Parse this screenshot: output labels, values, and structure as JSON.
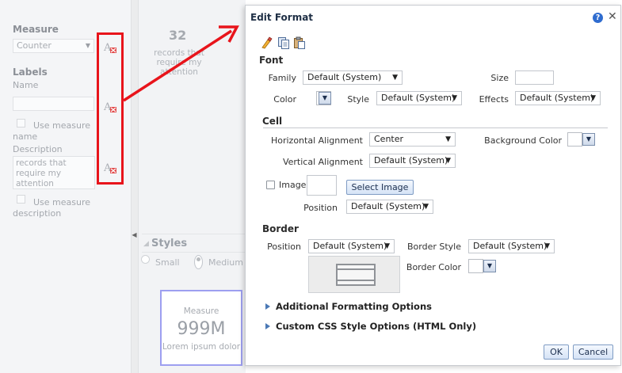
{
  "left_panel": {
    "measure_heading": "Measure",
    "measure_select": "Counter",
    "labels_heading": "Labels",
    "name_label": "Name",
    "name_value": "",
    "use_measure_name_line1": "Use measure",
    "use_measure_name_line2": "name",
    "description_label": "Description",
    "description_value": "records that require my attention",
    "use_measure_desc_line1": "Use measure",
    "use_measure_desc_line2": "description"
  },
  "tile": {
    "count": "32",
    "text": "records that require my attention"
  },
  "styles": {
    "heading": "Styles",
    "small": "Small",
    "medium": "Medium"
  },
  "preview": {
    "measure": "Measure",
    "value": "999M",
    "lorem": "Lorem ipsum dolor"
  },
  "dialog": {
    "title": "Edit Format",
    "help": "?",
    "close": "✕",
    "font": {
      "heading": "Font",
      "family_label": "Family",
      "family_value": "Default (System)",
      "size_label": "Size",
      "size_value": "",
      "color_label": "Color",
      "style_label": "Style",
      "style_value": "Default (System)",
      "effects_label": "Effects",
      "effects_value": "Default (System)"
    },
    "cell": {
      "heading": "Cell",
      "halign_label": "Horizontal Alignment",
      "halign_value": "Center",
      "bg_color_label": "Background Color",
      "valign_label": "Vertical Alignment",
      "valign_value": "Default (System)",
      "image_label": "Image",
      "select_image": "Select Image",
      "position_label": "Position",
      "position_value": "Default (System)"
    },
    "border": {
      "heading": "Border",
      "position_label": "Position",
      "position_value": "Default (System)",
      "style_label": "Border Style",
      "style_value": "Default (System)",
      "color_label": "Border Color"
    },
    "additional": "Additional Formatting Options",
    "custom_css": "Custom CSS Style Options (HTML Only)",
    "ok": "OK",
    "cancel": "Cancel"
  },
  "colors": {
    "annotation_red": "#e8141b",
    "help_blue": "#2f6ccf",
    "preview_border": "#9d9ff0"
  }
}
